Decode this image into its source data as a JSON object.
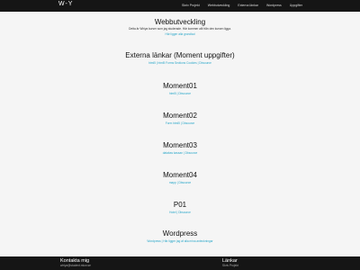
{
  "header": {
    "brand": "W-Y",
    "nav": [
      "Skriv Projekt",
      "Webbutveckling",
      "Externa länkar",
      "Wordpress",
      "Uppgifter"
    ]
  },
  "sections": [
    {
      "title": "Webbutveckling",
      "desc": "Detta är Wiriya kurser som jag studerade. Här kommer allt från den kursen ligga.",
      "link": "Här ligger alla grundlad"
    },
    {
      "title": "Externa länkar (Moment uppgifter)",
      "desc": "",
      "link": "html5 | html5 Forms Sections Cookies | Dbsource"
    },
    {
      "title": "Moment01",
      "desc": "",
      "link": "html5 | Dbsource"
    },
    {
      "title": "Moment02",
      "desc": "",
      "link": "Form html5 | Dbsource"
    },
    {
      "title": "Moment03",
      "desc": "",
      "link": "databas kassan | Dbsource"
    },
    {
      "title": "Moment04",
      "desc": "",
      "link": "mapp | Dbsource"
    },
    {
      "title": "P01",
      "desc": "",
      "link": "Hotel | Dbsource"
    },
    {
      "title": "Wordpress",
      "desc": "",
      "link": "Wordpress | Här ligger jag af alla mina anteckningar"
    }
  ],
  "footer": {
    "contact_title": "Kontakta mig",
    "contact_email": "wiriya@student.miun.se",
    "links_title": "Länkar",
    "links_sub": "Skriv Projekt"
  }
}
